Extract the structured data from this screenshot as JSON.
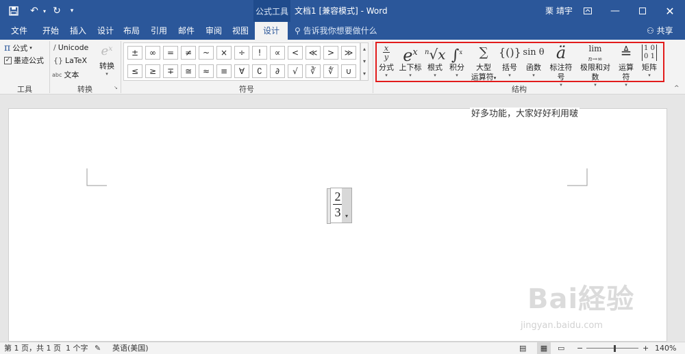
{
  "titlebar": {
    "context_tab": "公式工具",
    "doc_title": "文档1 [兼容模式] - Word",
    "user": "栗 靖宇"
  },
  "tabs": [
    "文件",
    "开始",
    "插入",
    "设计",
    "布局",
    "引用",
    "邮件",
    "审阅",
    "视图",
    "设计"
  ],
  "tell_me": "告诉我你想要做什么",
  "share": "共享",
  "tools": {
    "equation": "公式",
    "ink": "墨迹公式",
    "label": "工具"
  },
  "conversion": {
    "unicode": "Unicode",
    "latex": "LaTeX",
    "text": "文本",
    "convert": "转换",
    "label": "转换"
  },
  "symbols": {
    "row1": [
      "±",
      "∞",
      "=",
      "≠",
      "~",
      "×",
      "÷",
      "!",
      "∝",
      "<",
      "≪",
      ">",
      "≫"
    ],
    "row2": [
      "≤",
      "≥",
      "∓",
      "≅",
      "≈",
      "≡",
      "∀",
      "∁",
      "∂",
      "√",
      "∛",
      "∜",
      "∪"
    ],
    "label": "符号"
  },
  "structures": {
    "items": [
      {
        "label": "分式",
        "icon": "fraction-icon"
      },
      {
        "label": "上下标",
        "icon": "script-icon"
      },
      {
        "label": "根式",
        "icon": "radical-icon"
      },
      {
        "label": "积分",
        "icon": "integral-icon"
      },
      {
        "label": "大型",
        "label2": "运算符",
        "icon": "large-operator-icon"
      },
      {
        "label": "括号",
        "icon": "bracket-icon"
      },
      {
        "label": "函数",
        "icon": "function-icon"
      },
      {
        "label": "标注符号",
        "icon": "accent-icon"
      },
      {
        "label": "极限和对数",
        "icon": "limit-icon"
      },
      {
        "label": "运算符",
        "icon": "operator-icon"
      },
      {
        "label": "矩阵",
        "icon": "matrix-icon"
      }
    ],
    "label": "结构"
  },
  "annotation": "好多功能，大家好好利用啵",
  "equation": {
    "numerator": "2",
    "denominator": "3"
  },
  "status": {
    "page": "第 1 页，共 1 页",
    "words": "1 个字",
    "language": "英语(美国)",
    "zoom": "140%"
  },
  "watermark": {
    "brand": "Bai経验",
    "url": "jingyan.baidu.com"
  }
}
